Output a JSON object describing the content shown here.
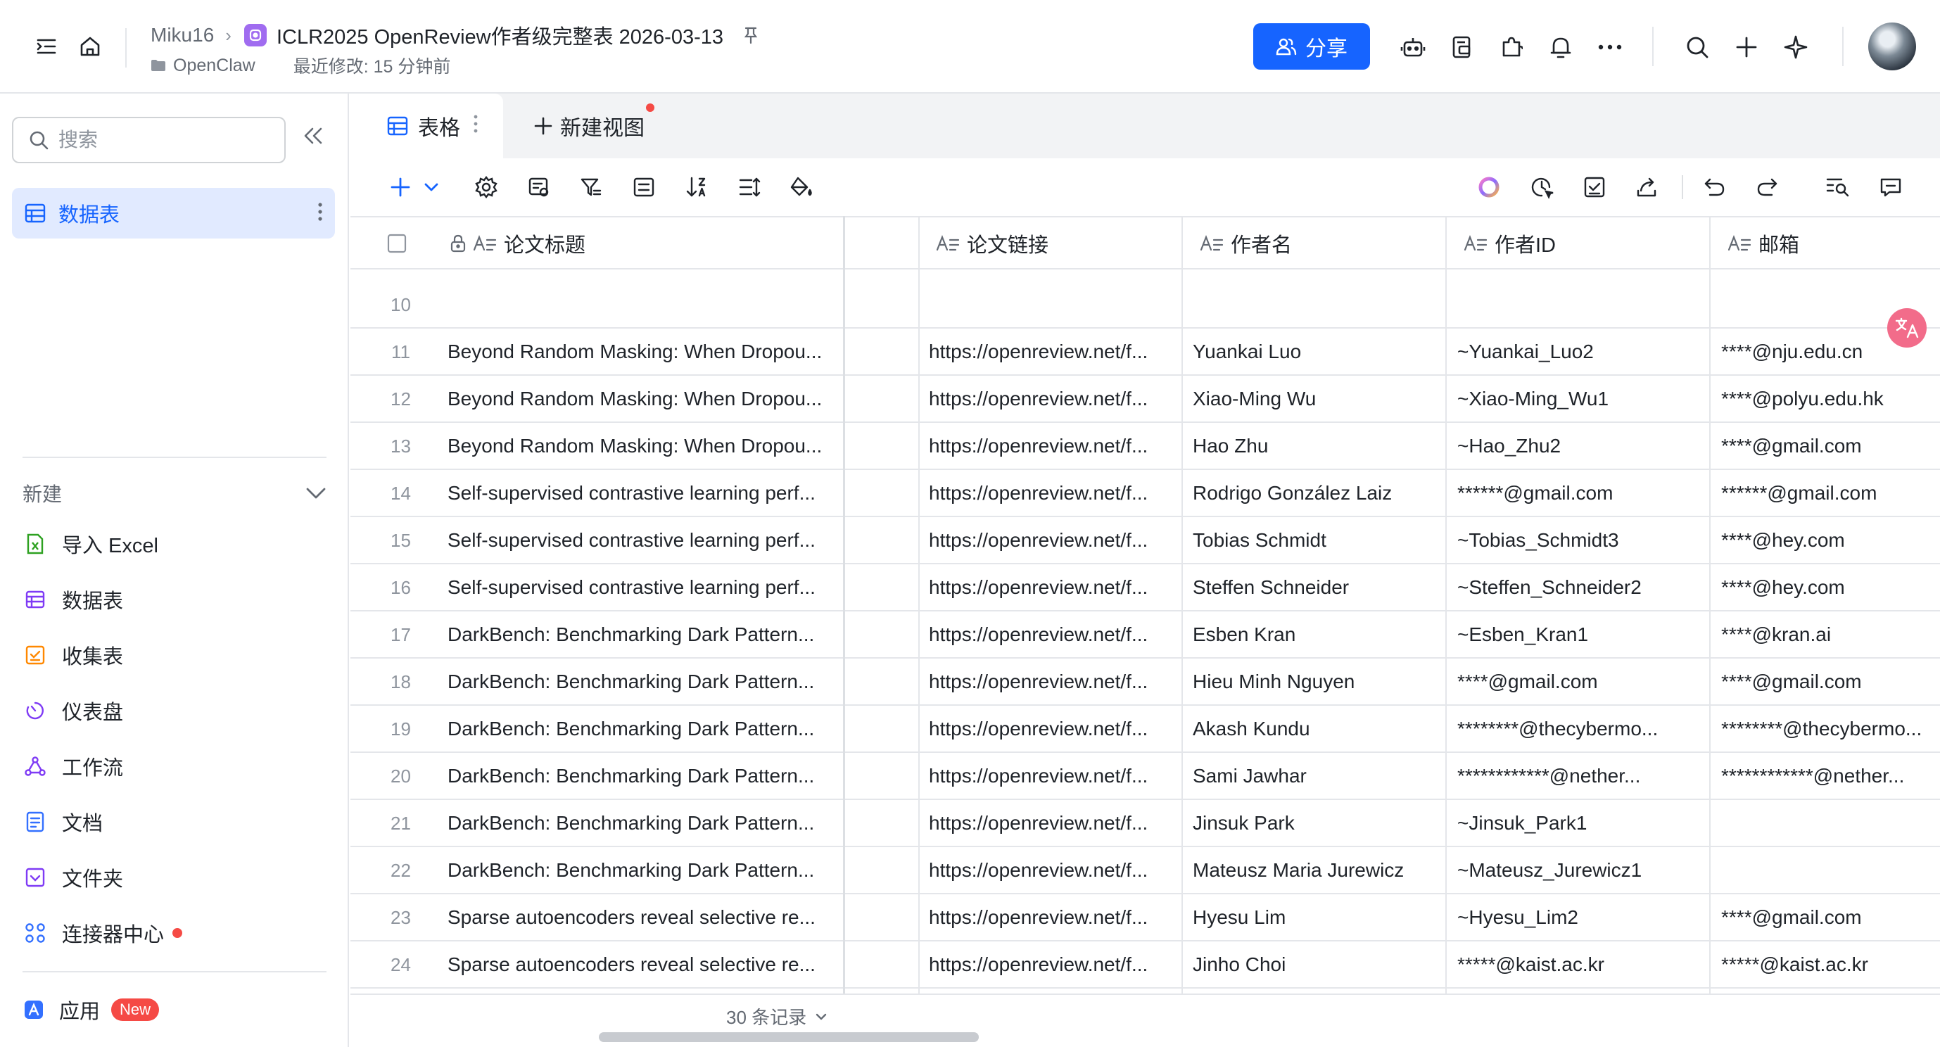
{
  "header": {
    "user": "Miku16",
    "doc_title": "ICLR2025 OpenReview作者级完整表 2026-03-13",
    "folder": "OpenClaw",
    "modified": "最近修改: 15 分钟前",
    "share_label": "分享"
  },
  "sidebar": {
    "search_placeholder": "搜索",
    "active_table": "数据表",
    "new_label": "新建",
    "items": [
      {
        "label": "导入 Excel",
        "icon": "excel-icon",
        "color": "#2ea121"
      },
      {
        "label": "数据表",
        "icon": "table-icon",
        "color": "#7f3bf5"
      },
      {
        "label": "收集表",
        "icon": "form-icon",
        "color": "#ff8800"
      },
      {
        "label": "仪表盘",
        "icon": "dashboard-icon",
        "color": "#7f3bf5"
      },
      {
        "label": "工作流",
        "icon": "workflow-icon",
        "color": "#7f3bf5"
      },
      {
        "label": "文档",
        "icon": "doc-icon",
        "color": "#3370ff"
      },
      {
        "label": "文件夹",
        "icon": "folder-icon",
        "color": "#7f3bf5"
      },
      {
        "label": "连接器中心",
        "icon": "connector-icon",
        "color": "#3370ff"
      }
    ],
    "apps_label": "应用",
    "apps_badge": "New"
  },
  "tabs": {
    "active": "表格",
    "new_view": "新建视图"
  },
  "columns": [
    "论文标题",
    "论文链接",
    "作者名",
    "作者ID",
    "邮箱"
  ],
  "rows": [
    {
      "n": "10",
      "title": "",
      "link": "",
      "name": "",
      "id": "",
      "email": ""
    },
    {
      "n": "11",
      "title": "Beyond Random Masking: When Dropou...",
      "link": "https://openreview.net/f...",
      "name": "Yuankai Luo",
      "id": "~Yuankai_Luo2",
      "email": "****@nju.edu.cn"
    },
    {
      "n": "12",
      "title": "Beyond Random Masking: When Dropou...",
      "link": "https://openreview.net/f...",
      "name": "Xiao-Ming Wu",
      "id": "~Xiao-Ming_Wu1",
      "email": "****@polyu.edu.hk"
    },
    {
      "n": "13",
      "title": "Beyond Random Masking: When Dropou...",
      "link": "https://openreview.net/f...",
      "name": "Hao Zhu",
      "id": "~Hao_Zhu2",
      "email": "****@gmail.com"
    },
    {
      "n": "14",
      "title": "Self-supervised contrastive learning perf...",
      "link": "https://openreview.net/f...",
      "name": "Rodrigo González Laiz",
      "id": "******@gmail.com",
      "email": "******@gmail.com"
    },
    {
      "n": "15",
      "title": "Self-supervised contrastive learning perf...",
      "link": "https://openreview.net/f...",
      "name": "Tobias Schmidt",
      "id": "~Tobias_Schmidt3",
      "email": "****@hey.com"
    },
    {
      "n": "16",
      "title": "Self-supervised contrastive learning perf...",
      "link": "https://openreview.net/f...",
      "name": "Steffen Schneider",
      "id": "~Steffen_Schneider2",
      "email": "****@hey.com"
    },
    {
      "n": "17",
      "title": "DarkBench: Benchmarking Dark Pattern...",
      "link": "https://openreview.net/f...",
      "name": "Esben Kran",
      "id": "~Esben_Kran1",
      "email": "****@kran.ai"
    },
    {
      "n": "18",
      "title": "DarkBench: Benchmarking Dark Pattern...",
      "link": "https://openreview.net/f...",
      "name": "Hieu Minh Nguyen",
      "id": "****@gmail.com",
      "email": "****@gmail.com"
    },
    {
      "n": "19",
      "title": "DarkBench: Benchmarking Dark Pattern...",
      "link": "https://openreview.net/f...",
      "name": "Akash Kundu",
      "id": "********@thecybermo...",
      "email": "********@thecybermo..."
    },
    {
      "n": "20",
      "title": "DarkBench: Benchmarking Dark Pattern...",
      "link": "https://openreview.net/f...",
      "name": "Sami Jawhar",
      "id": "************@nether...",
      "email": "************@nether..."
    },
    {
      "n": "21",
      "title": "DarkBench: Benchmarking Dark Pattern...",
      "link": "https://openreview.net/f...",
      "name": "Jinsuk Park",
      "id": "~Jinsuk_Park1",
      "email": ""
    },
    {
      "n": "22",
      "title": "DarkBench: Benchmarking Dark Pattern...",
      "link": "https://openreview.net/f...",
      "name": "Mateusz Maria Jurewicz",
      "id": "~Mateusz_Jurewicz1",
      "email": ""
    },
    {
      "n": "23",
      "title": "Sparse autoencoders reveal selective re...",
      "link": "https://openreview.net/f...",
      "name": "Hyesu Lim",
      "id": "~Hyesu_Lim2",
      "email": "****@gmail.com"
    },
    {
      "n": "24",
      "title": "Sparse autoencoders reveal selective re...",
      "link": "https://openreview.net/f...",
      "name": "Jinho Choi",
      "id": "*****@kaist.ac.kr",
      "email": "*****@kaist.ac.kr"
    }
  ],
  "footer": {
    "records": "30 条记录"
  },
  "colors": {
    "accent": "#1664ff",
    "active_bg": "#e1eaff",
    "badge_red": "#f54a45"
  }
}
